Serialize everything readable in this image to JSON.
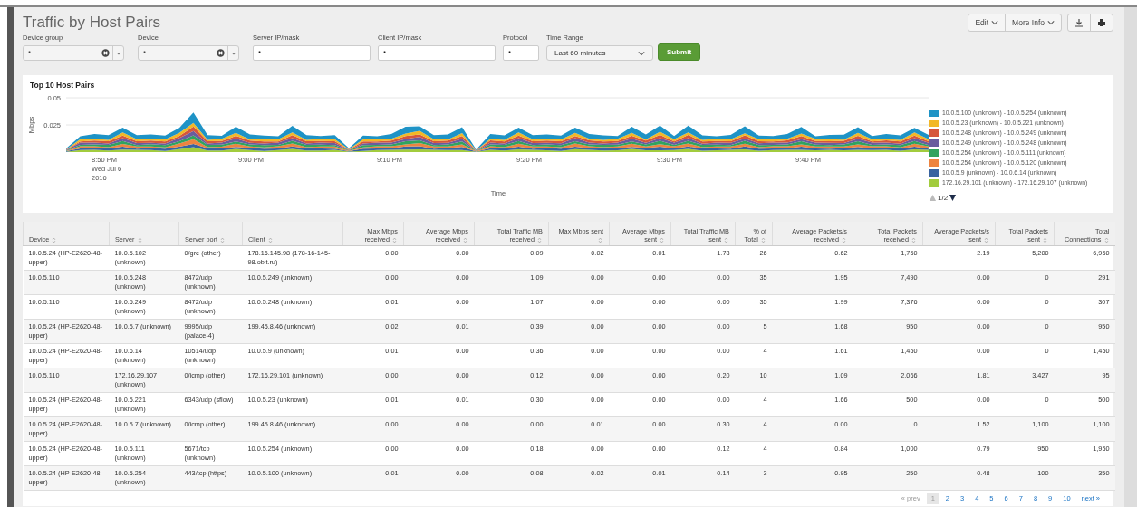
{
  "title": "Traffic by Host Pairs",
  "header_buttons": [
    {
      "label": "Edit",
      "kind": "menu"
    },
    {
      "label": "More Info",
      "kind": "menu"
    }
  ],
  "header_tools": [
    {
      "kind": "download"
    },
    {
      "kind": "print"
    }
  ],
  "inputs": [
    {
      "label": "Device group",
      "kind": "combo",
      "value": "*"
    },
    {
      "label": "Device",
      "kind": "combo",
      "value": "*"
    },
    {
      "label": "Server IP/mask",
      "kind": "text",
      "value": "*"
    },
    {
      "label": "Client IP/mask",
      "kind": "text",
      "value": "*"
    },
    {
      "label": "Protocol",
      "kind": "short",
      "value": "*"
    },
    {
      "label": "Time Range",
      "kind": "select",
      "value": "Last 60 minutes"
    }
  ],
  "submit": "Submit",
  "chart_panel": {
    "title": "Top 10 Host Pairs",
    "ylabel": "Mbps",
    "yticks": [
      "0.05",
      "0.025"
    ],
    "xticks": [
      {
        "label": "8:50 PM",
        "sub": [
          "Wed Jul 6",
          "2016"
        ]
      },
      {
        "label": "9:00 PM"
      },
      {
        "label": "9:10 PM"
      },
      {
        "label": "9:20 PM"
      },
      {
        "label": "9:30 PM"
      },
      {
        "label": "9:40 PM"
      }
    ],
    "xlabel": "Time",
    "legend": [
      {
        "label": "10.0.5.100 (unknown) - 10.0.5.254 (unknown)",
        "color": "#1e93c6"
      },
      {
        "label": "10.0.5.23 (unknown) - 10.0.5.221 (unknown)",
        "color": "#f2b827"
      },
      {
        "label": "10.0.5.248 (unknown) - 10.0.5.249 (unknown)",
        "color": "#d6563c"
      },
      {
        "label": "10.0.5.249 (unknown) - 10.0.5.248 (unknown)",
        "color": "#6a5c9e"
      },
      {
        "label": "10.0.5.254 (unknown) - 10.0.5.111 (unknown)",
        "color": "#31a35f"
      },
      {
        "label": "10.0.5.254 (unknown) - 10.0.5.120 (unknown)",
        "color": "#ed8440"
      },
      {
        "label": "10.0.5.9 (unknown) - 10.0.6.14 (unknown)",
        "color": "#3863a0"
      },
      {
        "label": "172.16.29.101 (unknown) - 172.16.29.107 (unknown)",
        "color": "#a2cc3e"
      }
    ],
    "legend_page": "1/2"
  },
  "table": {
    "columns": [
      {
        "label": "Device",
        "kind": "text"
      },
      {
        "label": "Server",
        "kind": "text"
      },
      {
        "label": "Server port",
        "kind": "text"
      },
      {
        "label": "Client",
        "kind": "text"
      },
      {
        "label": "Max Mbps received",
        "kind": "number"
      },
      {
        "label": "Average Mbps received",
        "kind": "number"
      },
      {
        "label": "Total Traffic MB received",
        "kind": "number"
      },
      {
        "label": "Max Mbps sent",
        "kind": "number"
      },
      {
        "label": "Average Mbps sent",
        "kind": "number"
      },
      {
        "label": "Total Traffic MB sent",
        "kind": "number"
      },
      {
        "label": "% of Total",
        "kind": "number"
      },
      {
        "label": "Average Packets/s received",
        "kind": "number"
      },
      {
        "label": "Total Packets received",
        "kind": "number"
      },
      {
        "label": "Average Packets/s sent",
        "kind": "number"
      },
      {
        "label": "Total Packets sent",
        "kind": "number"
      },
      {
        "label": "Total Connections",
        "kind": "number"
      }
    ],
    "rows": [
      [
        "10.0.5.24 (HP-E2620-48-upper)",
        "10.0.5.102 (unknown)",
        "0/gre (other)",
        "178.16.145.98 (178-16-145-98.obit.ru)",
        "0.00",
        "0.00",
        "0.09",
        "0.02",
        "0.01",
        "1.78",
        "26",
        "0.62",
        "1,750",
        "2.19",
        "5,200",
        "6,950"
      ],
      [
        "10.0.5.110",
        "10.0.5.248 (unknown)",
        "8472/udp (unknown)",
        "10.0.5.249 (unknown)",
        "0.00",
        "0.00",
        "1.09",
        "0.00",
        "0.00",
        "0.00",
        "35",
        "1.95",
        "7,490",
        "0.00",
        "0",
        "291"
      ],
      [
        "10.0.5.110",
        "10.0.5.249 (unknown)",
        "8472/udp (unknown)",
        "10.0.5.248 (unknown)",
        "0.01",
        "0.00",
        "1.07",
        "0.00",
        "0.00",
        "0.00",
        "35",
        "1.99",
        "7,376",
        "0.00",
        "0",
        "307"
      ],
      [
        "10.0.5.24 (HP-E2620-48-upper)",
        "10.0.5.7 (unknown)",
        "9995/udp (palace-4)",
        "199.45.8.46 (unknown)",
        "0.02",
        "0.01",
        "0.39",
        "0.00",
        "0.00",
        "0.00",
        "5",
        "1.68",
        "950",
        "0.00",
        "0",
        "950"
      ],
      [
        "10.0.5.24 (HP-E2620-48-upper)",
        "10.0.6.14 (unknown)",
        "10514/udp (unknown)",
        "10.0.5.9 (unknown)",
        "0.01",
        "0.00",
        "0.36",
        "0.00",
        "0.00",
        "0.00",
        "4",
        "1.61",
        "1,450",
        "0.00",
        "0",
        "1,450"
      ],
      [
        "10.0.5.110",
        "172.16.29.107 (unknown)",
        "0/icmp (other)",
        "172.16.29.101 (unknown)",
        "0.00",
        "0.00",
        "0.12",
        "0.00",
        "0.00",
        "0.20",
        "10",
        "1.09",
        "2,066",
        "1.81",
        "3,427",
        "95"
      ],
      [
        "10.0.5.24 (HP-E2620-48-upper)",
        "10.0.5.221 (unknown)",
        "6343/udp (sflow)",
        "10.0.5.23 (unknown)",
        "0.01",
        "0.01",
        "0.30",
        "0.00",
        "0.00",
        "0.00",
        "4",
        "1.66",
        "500",
        "0.00",
        "0",
        "500"
      ],
      [
        "10.0.5.24 (HP-E2620-48-upper)",
        "10.0.5.7 (unknown)",
        "0/icmp (other)",
        "199.45.8.46 (unknown)",
        "0.00",
        "0.00",
        "0.00",
        "0.01",
        "0.00",
        "0.30",
        "4",
        "0.00",
        "0",
        "1.52",
        "1,100",
        "1,100"
      ],
      [
        "10.0.5.24 (HP-E2620-48-upper)",
        "10.0.5.111 (unknown)",
        "5671/tcp (unknown)",
        "10.0.5.254 (unknown)",
        "0.00",
        "0.00",
        "0.18",
        "0.00",
        "0.00",
        "0.12",
        "4",
        "0.84",
        "1,000",
        "0.79",
        "950",
        "1,950"
      ],
      [
        "10.0.5.24 (HP-E2620-48-upper)",
        "10.0.5.254 (unknown)",
        "443/tcp (https)",
        "10.0.5.100 (unknown)",
        "0.01",
        "0.00",
        "0.08",
        "0.02",
        "0.01",
        "0.14",
        "3",
        "0.95",
        "250",
        "0.48",
        "100",
        "350"
      ]
    ]
  },
  "pagination": {
    "prev": "« prev",
    "prev_disabled": true,
    "pages": [
      {
        "label": "1",
        "selected": true
      },
      {
        "label": "2",
        "selected": false
      },
      {
        "label": "3",
        "selected": false
      },
      {
        "label": "4",
        "selected": false
      },
      {
        "label": "5",
        "selected": false
      },
      {
        "label": "6",
        "selected": false
      },
      {
        "label": "7",
        "selected": false
      },
      {
        "label": "8",
        "selected": false
      },
      {
        "label": "9",
        "selected": false
      },
      {
        "label": "10",
        "selected": false
      }
    ],
    "next": "next »"
  }
}
